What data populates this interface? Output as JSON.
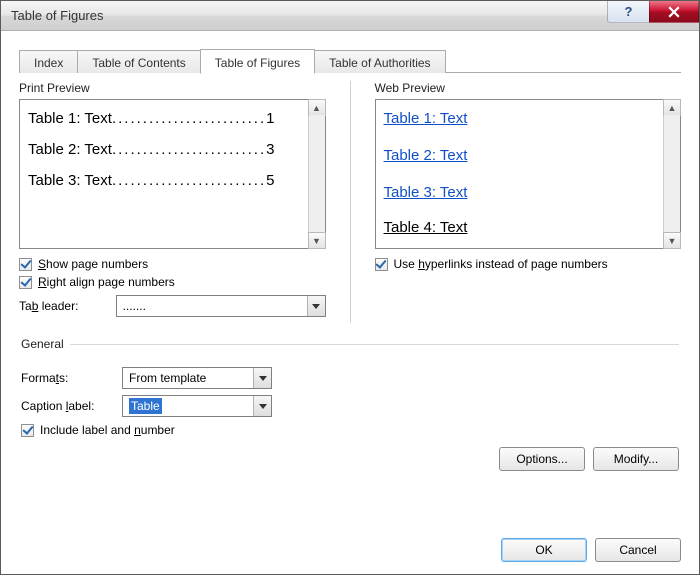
{
  "title": "Table of Figures",
  "tabs": [
    "Index",
    "Table of Contents",
    "Table of Figures",
    "Table of Authorities"
  ],
  "active_tab": 2,
  "print_preview": {
    "label": "Print Preview",
    "rows": [
      {
        "text": "Table 1: Text",
        "page": "1"
      },
      {
        "text": "Table 2: Text",
        "page": "3"
      },
      {
        "text": "Table 3: Text",
        "page": "5"
      }
    ]
  },
  "web_preview": {
    "label": "Web Preview",
    "links": [
      "Table 1: Text",
      "Table 2: Text",
      "Table 3: Text",
      "Table 4: Text"
    ]
  },
  "options": {
    "show_page_numbers": {
      "label_pre": "",
      "key": "S",
      "label_post": "how page numbers",
      "checked": true
    },
    "right_align": {
      "key": "R",
      "label_post": "ight align page numbers",
      "checked": true
    },
    "tab_leader_label_pre": "Ta",
    "tab_leader_key": "b",
    "tab_leader_label_post": " leader:",
    "tab_leader_value": ".......",
    "use_hyperlinks": {
      "label_pre": "Use ",
      "key": "h",
      "label_post": "yperlinks instead of page numbers",
      "checked": true
    }
  },
  "general": {
    "legend": "General",
    "formats_label_pre": "Forma",
    "formats_key": "t",
    "formats_label_post": "s:",
    "formats_value": "From template",
    "caption_label_pre": "Caption ",
    "caption_key": "l",
    "caption_label_post": "abel:",
    "caption_value": "Table",
    "include": {
      "label_pre": "Include label and ",
      "key": "n",
      "label_post": "umber",
      "checked": true
    }
  },
  "buttons": {
    "options": "Options...",
    "modify": "Modify...",
    "ok": "OK",
    "cancel": "Cancel"
  }
}
